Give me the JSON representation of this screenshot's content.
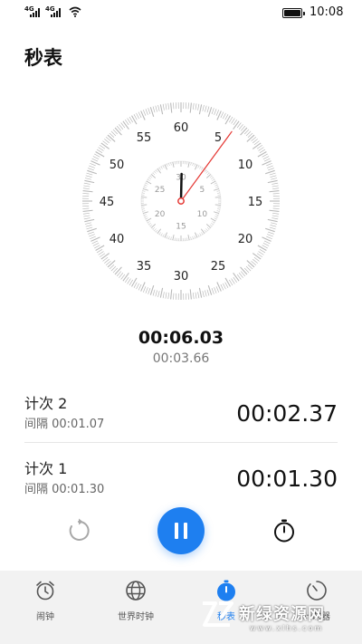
{
  "status_bar": {
    "sim1": "4G",
    "sim2": "4G",
    "time": "10:08"
  },
  "page": {
    "title": "秒表"
  },
  "dial": {
    "outer_numbers": [
      "60",
      "5",
      "10",
      "15",
      "20",
      "25",
      "30",
      "35",
      "40",
      "45",
      "50",
      "55"
    ],
    "inner_numbers": [
      "30",
      "5",
      "10",
      "15",
      "20",
      "25"
    ],
    "seconds_hand_value": 6.03,
    "minutes_hand_value": 0.1,
    "hand_color": "#e53935",
    "tick_color": "#b9b9b9"
  },
  "display": {
    "main_time": "00:06.03",
    "current_lap_time": "00:03.66"
  },
  "laps": [
    {
      "title": "计次 2",
      "interval": "间隔 00:01.07",
      "total": "00:02.37"
    },
    {
      "title": "计次 1",
      "interval": "间隔 00:01.30",
      "total": "00:01.30"
    }
  ],
  "controls": {
    "accent": "#1e7ff0"
  },
  "tabs": [
    {
      "label": "闹钟",
      "icon": "alarm-clock-icon"
    },
    {
      "label": "世界时钟",
      "icon": "globe-icon"
    },
    {
      "label": "秒表",
      "icon": "stopwatch-icon",
      "active": true
    },
    {
      "label": "计时器",
      "icon": "timer-icon"
    }
  ],
  "watermark": {
    "text": "新绿资源网",
    "url": "www.xlhs.com"
  }
}
